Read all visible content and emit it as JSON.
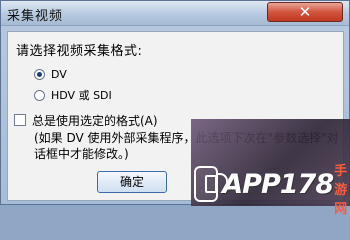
{
  "window": {
    "title": "采集视频",
    "close_label": "✕"
  },
  "dialog": {
    "prompt": "请选择视频采集格式:",
    "options": [
      {
        "label": "DV",
        "selected": true
      },
      {
        "label": "HDV 或 SDI",
        "selected": false
      }
    ],
    "always_use_label": "总是使用选定的格式(A)",
    "always_use_checked": false,
    "note": "(如果 DV 使用外部采集程序，此选项下次在\"参数选择\"对话框中才能修改。)",
    "ok_label": "确定"
  },
  "watermark": {
    "logo_icon": "phone-signal-icon",
    "brand": "APP178",
    "sub": "手游网"
  }
}
